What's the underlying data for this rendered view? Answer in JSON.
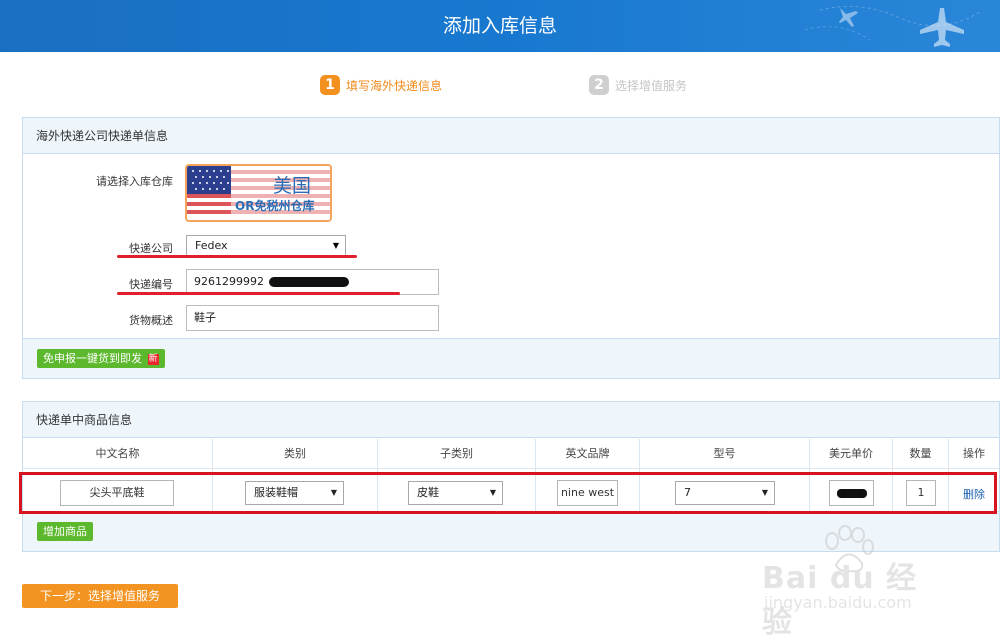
{
  "header": {
    "title": "添加入库信息"
  },
  "steps": [
    {
      "num": "1",
      "label": "填写海外快递信息"
    },
    {
      "num": "2",
      "label": "选择增值服务"
    }
  ],
  "express_panel": {
    "title": "海外快递公司快递单信息",
    "warehouse_label": "请选择入库仓库",
    "warehouse_country": "美国",
    "warehouse_name": "OR免税州仓库",
    "company_label": "快递公司",
    "company_value": "Fedex",
    "tracking_label": "快递编号",
    "tracking_value": "9261299992",
    "goods_label": "货物概述",
    "goods_value": "鞋子",
    "declare_button": "免申报一键货到即发",
    "new_badge": "新"
  },
  "goods_panel": {
    "title": "快递单中商品信息",
    "columns": [
      "中文名称",
      "类别",
      "子类别",
      "英文品牌",
      "型号",
      "美元单价",
      "数量",
      "操作"
    ],
    "row": {
      "name": "尖头平底鞋",
      "category": "服装鞋帽",
      "subcategory": "皮鞋",
      "brand": "nine west",
      "model": "7",
      "quantity": "1",
      "action": "删除"
    },
    "add_button": "增加商品"
  },
  "next_button": "下一步：选择增值服务",
  "watermark": {
    "brand": "Bai du 经验",
    "url": "jingyan.baidu.com"
  },
  "colors": {
    "header_blue": "#1a72c6",
    "accent_orange": "#f3911e",
    "green": "#5cb82c",
    "red": "#d7131f",
    "link_blue": "#1a5fb0"
  },
  "icons": [
    "airplane-icon",
    "dropdown-arrow-icon",
    "us-flag-icon",
    "paw-icon"
  ]
}
